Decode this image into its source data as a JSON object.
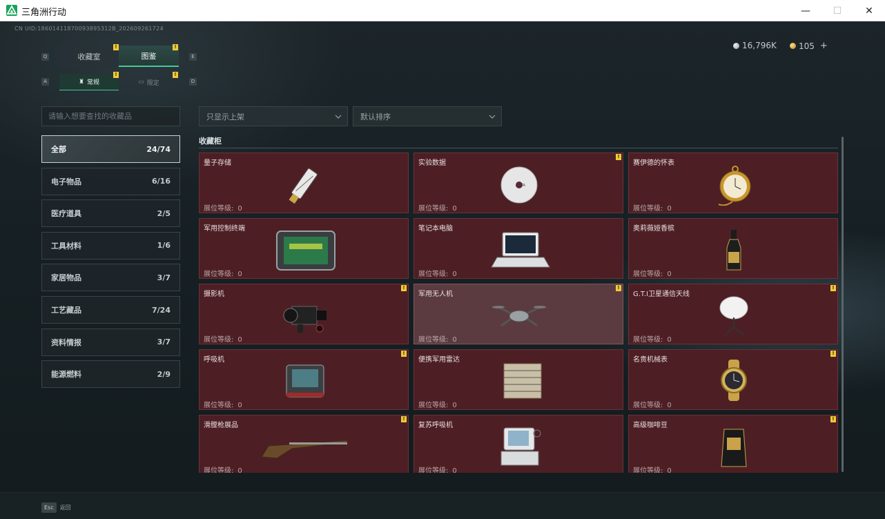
{
  "window": {
    "title": "三角洲行动",
    "minimize": "—",
    "maximize": "☐",
    "close": "✕"
  },
  "uid": "CN UID:18601411870093895312B_202609261724",
  "currency": {
    "silver": "16,796K",
    "gold": "105",
    "add": "+"
  },
  "tabs": [
    {
      "label": "收藏室",
      "key": "Q",
      "active": false
    },
    {
      "label": "图鉴",
      "key": "E",
      "active": true
    }
  ],
  "subtabs": [
    {
      "label": "常规",
      "key": "A",
      "active": true
    },
    {
      "label": "限定",
      "key": "D",
      "active": false
    }
  ],
  "search": {
    "placeholder": "请输入想要查找的收藏品"
  },
  "filters": {
    "shelf": "只显示上架",
    "sort": "默认排序"
  },
  "categories": [
    {
      "label": "全部",
      "count": "24/74",
      "active": true
    },
    {
      "label": "电子物品",
      "count": "6/16"
    },
    {
      "label": "医疗道具",
      "count": "2/5"
    },
    {
      "label": "工具材料",
      "count": "1/6"
    },
    {
      "label": "家居物品",
      "count": "3/7"
    },
    {
      "label": "工艺藏品",
      "count": "7/24"
    },
    {
      "label": "资料情报",
      "count": "3/7"
    },
    {
      "label": "能源燃料",
      "count": "2/9"
    }
  ],
  "cabinet": {
    "title": "收藏柜",
    "level_label": "展位等级:",
    "items": [
      {
        "name": "量子存储",
        "level": "0",
        "badge": false,
        "icon": "usb-drive-icon"
      },
      {
        "name": "实验数据",
        "level": "0",
        "badge": true,
        "icon": "disc-icon"
      },
      {
        "name": "赛伊德的怀表",
        "level": "0",
        "badge": false,
        "icon": "pocket-watch-icon"
      },
      {
        "name": "军用控制终端",
        "level": "0",
        "badge": false,
        "icon": "control-terminal-icon"
      },
      {
        "name": "笔记本电脑",
        "level": "0",
        "badge": false,
        "icon": "laptop-icon"
      },
      {
        "name": "奥莉薇娅香槟",
        "level": "0",
        "badge": false,
        "icon": "champagne-icon"
      },
      {
        "name": "摄影机",
        "level": "0",
        "badge": true,
        "icon": "camera-icon"
      },
      {
        "name": "军用无人机",
        "level": "0",
        "badge": true,
        "icon": "drone-icon",
        "highlight": true
      },
      {
        "name": "G.T.I卫星通信天线",
        "level": "0",
        "badge": true,
        "icon": "satellite-dish-icon"
      },
      {
        "name": "呼吸机",
        "level": "0",
        "badge": true,
        "icon": "ventilator-icon"
      },
      {
        "name": "便携军用雷达",
        "level": "0",
        "badge": false,
        "icon": "radar-icon"
      },
      {
        "name": "名贵机械表",
        "level": "0",
        "badge": true,
        "icon": "wristwatch-icon"
      },
      {
        "name": "滑膛枪展品",
        "level": "0",
        "badge": true,
        "icon": "musket-icon"
      },
      {
        "name": "复苏呼吸机",
        "level": "0",
        "badge": false,
        "icon": "resuscitator-icon"
      },
      {
        "name": "高级咖啡豆",
        "level": "0",
        "badge": true,
        "icon": "coffee-bag-icon"
      }
    ]
  },
  "footer": {
    "esc_key": "Esc",
    "esc_label": "返回"
  },
  "colors": {
    "accent": "#48c89a",
    "card_bg": "#4d1f24",
    "badge": "#f0c93a"
  }
}
